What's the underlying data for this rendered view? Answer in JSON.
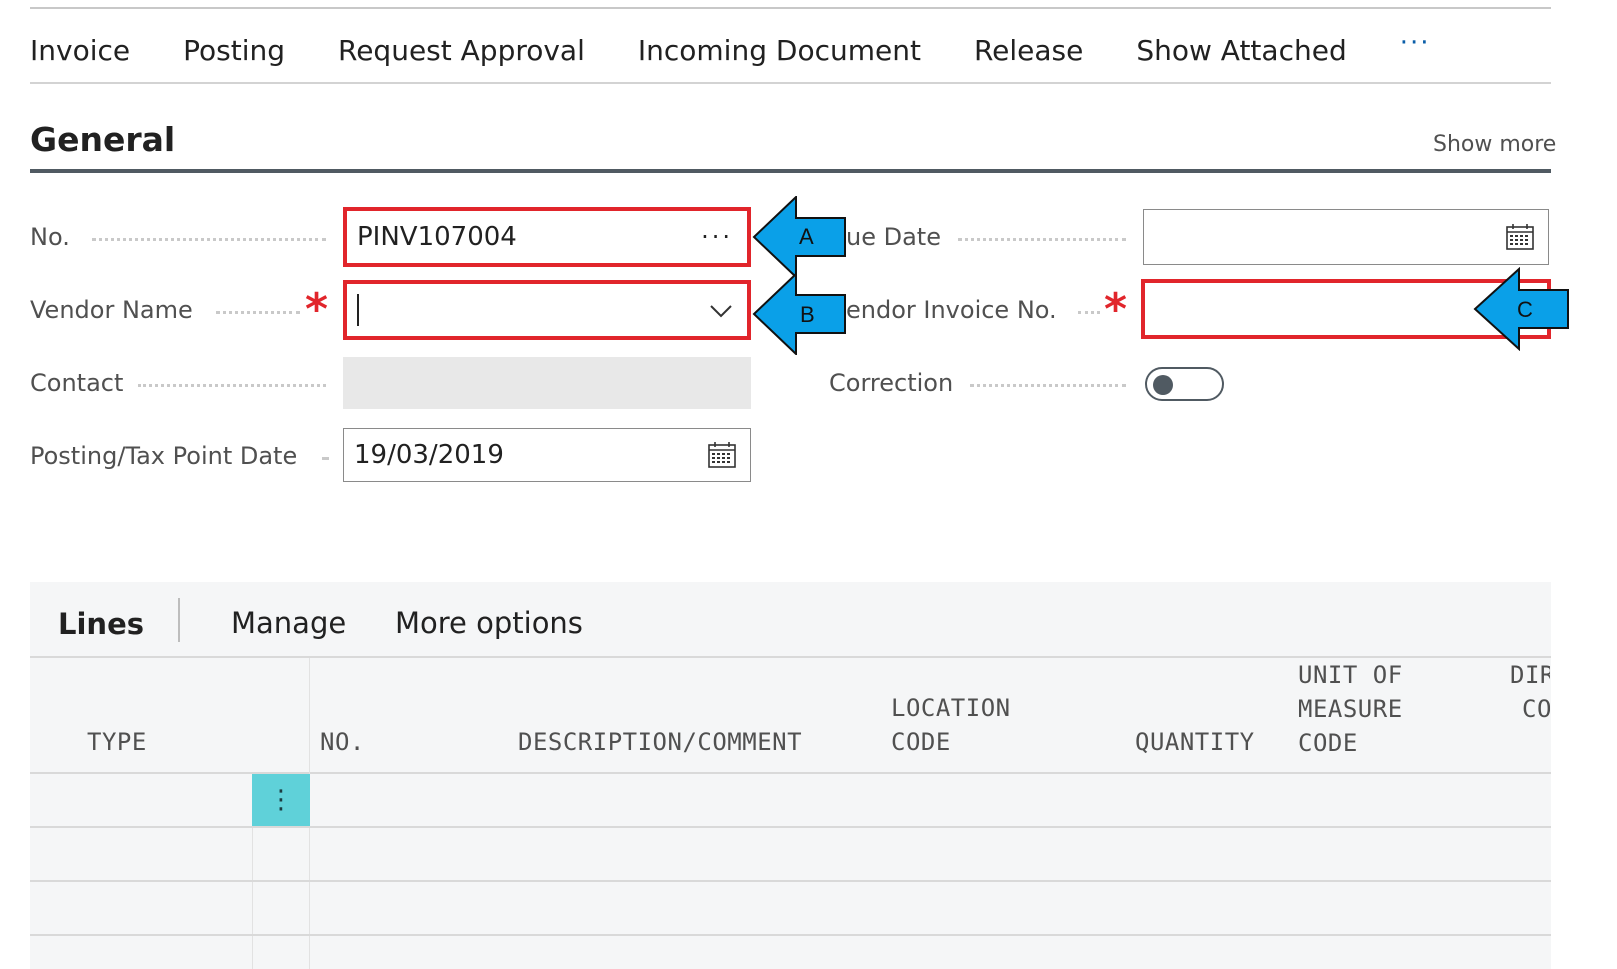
{
  "actions": [
    "Invoice",
    "Posting",
    "Request Approval",
    "Incoming Document",
    "Release",
    "Show Attached"
  ],
  "actions_more": "···",
  "section": {
    "title": "General",
    "show_more": "Show more"
  },
  "fields": {
    "no": {
      "label": "No.",
      "value": "PINV107004",
      "assist": "···"
    },
    "vendor_name": {
      "label": "Vendor Name",
      "value": ""
    },
    "contact": {
      "label": "Contact",
      "value": ""
    },
    "posting_date": {
      "label": "Posting/Tax Point Date",
      "value": "19/03/2019"
    },
    "due_date": {
      "label": "ue Date",
      "value": ""
    },
    "vendor_invoice_no": {
      "label": "endor Invoice No.",
      "value": ""
    },
    "correction": {
      "label": "Correction",
      "on": false
    }
  },
  "required_mark": "*",
  "callouts": {
    "a": "A",
    "b": "B",
    "c": "C"
  },
  "lines": {
    "tabs": {
      "lines": "Lines",
      "manage": "Manage",
      "more": "More options"
    },
    "columns": {
      "type": "TYPE",
      "no": "NO.",
      "description": "DESCRIPTION/COMMENT",
      "location_1": "LOCATION",
      "location_2": "CODE",
      "quantity": "QUANTITY",
      "uom_1": "UNIT OF",
      "uom_2": "MEASURE",
      "uom_3": "CODE",
      "dir_1": "DIR",
      "dir_2": "CO"
    },
    "row_menu": "⋮"
  },
  "colors": {
    "highlight": "#e1252b",
    "callout": "#0aa0e8",
    "row_menu": "#5fd1d9"
  },
  "icons": [
    "calendar-icon",
    "ellipsis-icon",
    "chevron-down-icon",
    "arrow-callout-icon"
  ]
}
